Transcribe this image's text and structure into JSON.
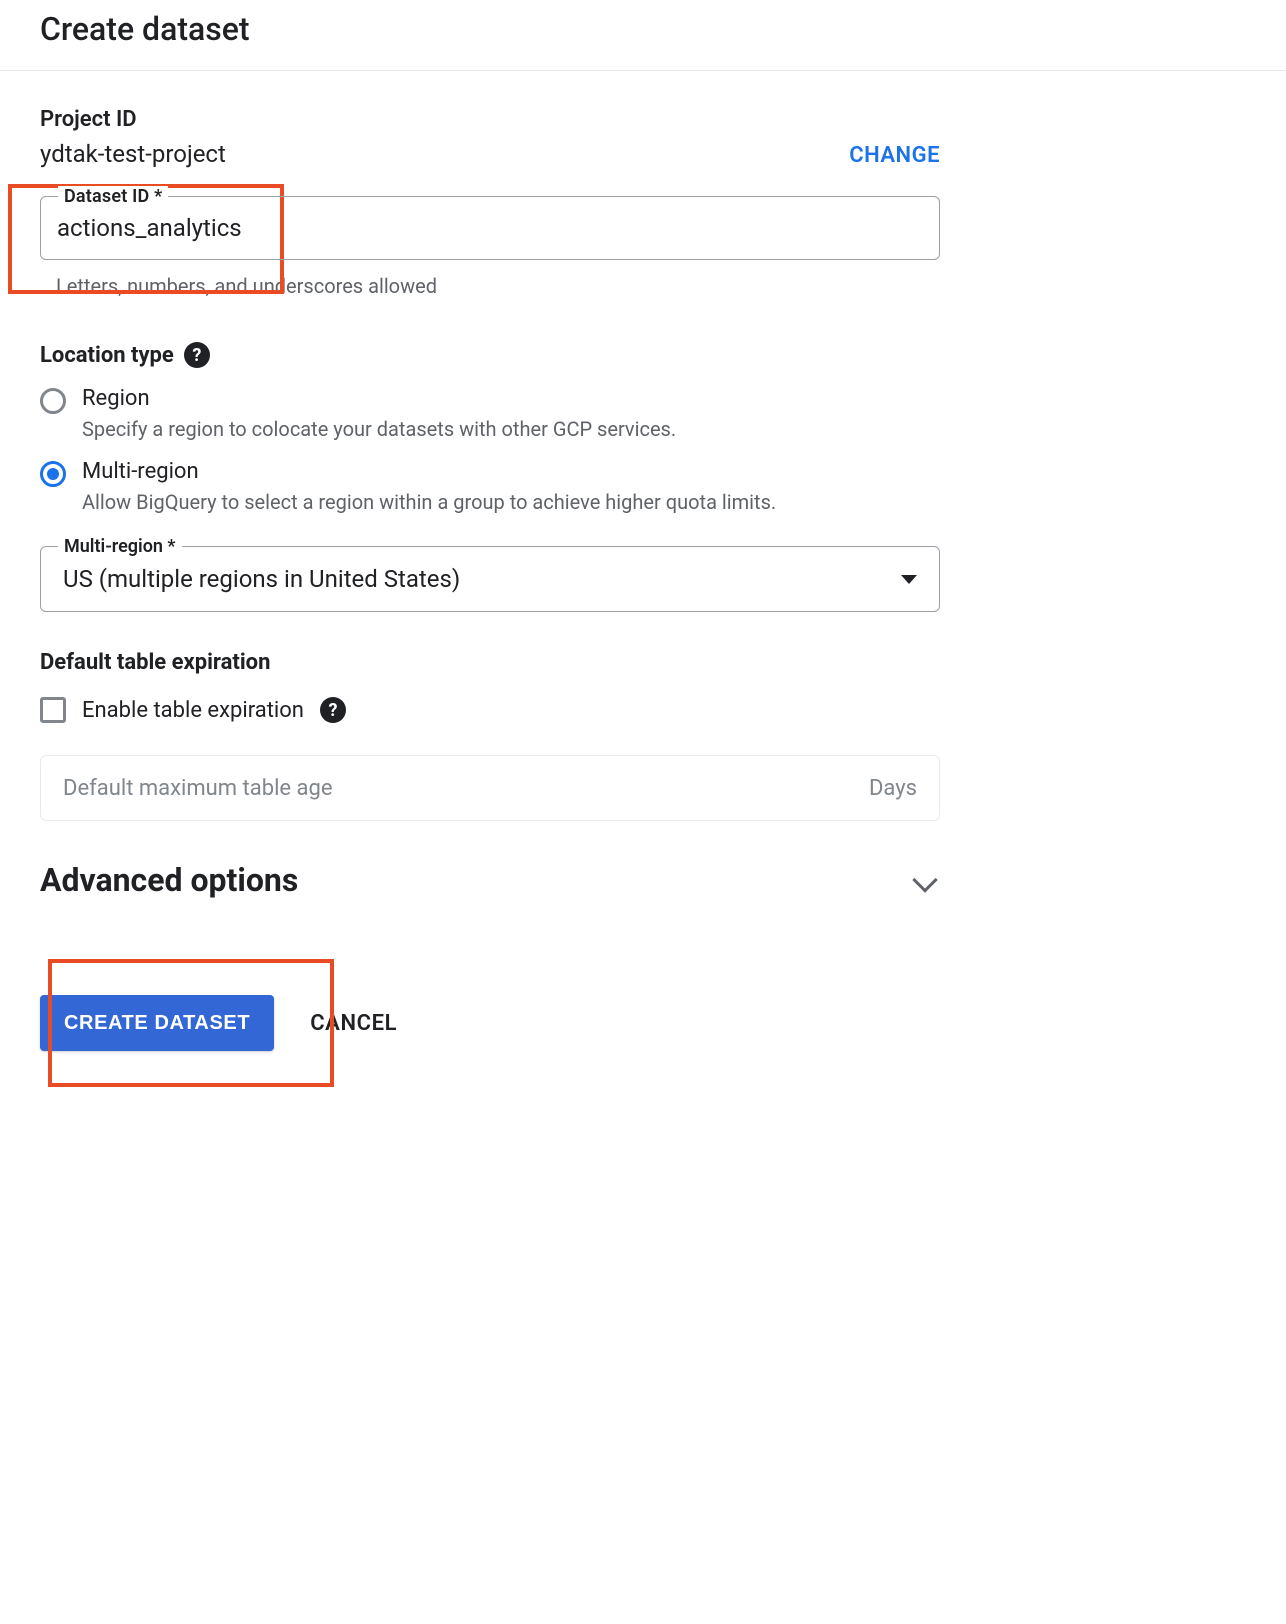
{
  "page": {
    "title": "Create dataset"
  },
  "project": {
    "label": "Project ID",
    "value": "ydtak-test-project",
    "change": "CHANGE"
  },
  "dataset_id": {
    "label": "Dataset ID *",
    "value": "actions_analytics",
    "helper": "Letters, numbers, and underscores allowed"
  },
  "location": {
    "heading": "Location type",
    "options": {
      "region": {
        "title": "Region",
        "desc": "Specify a region to colocate your datasets with other GCP services."
      },
      "multi": {
        "title": "Multi-region",
        "desc": "Allow BigQuery to select a region within a group to achieve higher quota limits."
      }
    },
    "select": {
      "label": "Multi-region *",
      "value": "US (multiple regions in United States)"
    }
  },
  "expiration": {
    "heading": "Default table expiration",
    "checkbox_label": "Enable table expiration",
    "placeholder": "Default maximum table age",
    "suffix": "Days"
  },
  "advanced": {
    "title": "Advanced options"
  },
  "actions": {
    "create": "CREATE DATASET",
    "cancel": "CANCEL"
  }
}
